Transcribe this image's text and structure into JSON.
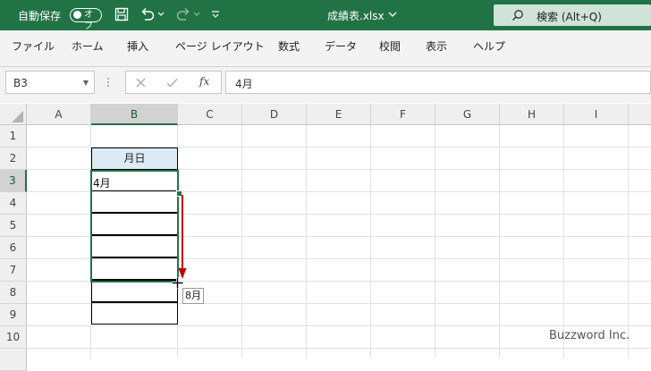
{
  "titlebar": {
    "autosave_label": "自動保存",
    "toggle_label": "オフ",
    "filename": "成績表.xlsx",
    "search_label": "検索 (Alt+Q)"
  },
  "ribbon": {
    "tabs": [
      "ファイル",
      "ホーム",
      "挿入",
      "ページ レイアウト",
      "数式",
      "データ",
      "校閲",
      "表示",
      "ヘルプ"
    ]
  },
  "formula_bar": {
    "name_box": "B3",
    "fx_label": "fx",
    "content": "4月"
  },
  "grid": {
    "columns": [
      "A",
      "B",
      "C",
      "D",
      "E",
      "F",
      "G",
      "H",
      "I"
    ],
    "selected_column": "B",
    "rows": [
      "1",
      "2",
      "3",
      "4",
      "5",
      "6",
      "7",
      "8",
      "9",
      "10"
    ],
    "selected_row": "3",
    "header_cell": "月日",
    "b3_value": "4月",
    "fill_tooltip": "8月"
  },
  "watermark": "Buzzword Inc.",
  "colors": {
    "excel_green": "#217346",
    "header_fill": "#ddebf7",
    "arrow_red": "#c00000"
  }
}
